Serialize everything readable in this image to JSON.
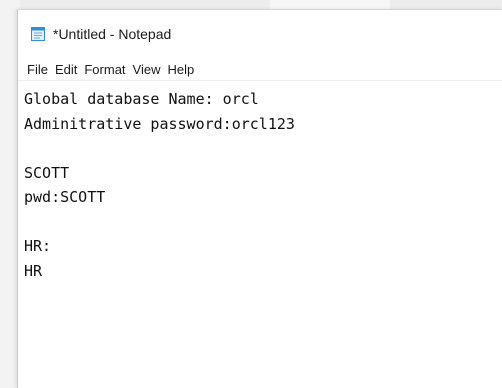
{
  "window": {
    "title": "*Untitled - Notepad"
  },
  "menu": {
    "items": [
      "File",
      "Edit",
      "Format",
      "View",
      "Help"
    ]
  },
  "editor": {
    "lines": [
      "Global database Name: orcl",
      "Adminitrative password:orcl123",
      "",
      "SCOTT",
      "pwd:SCOTT",
      "",
      "HR:",
      "HR"
    ]
  },
  "icons": {
    "app": "notepad-icon"
  },
  "colors": {
    "window_bg": "#ffffff",
    "text": "#111111",
    "icon_blue": "#2f8fd8"
  }
}
